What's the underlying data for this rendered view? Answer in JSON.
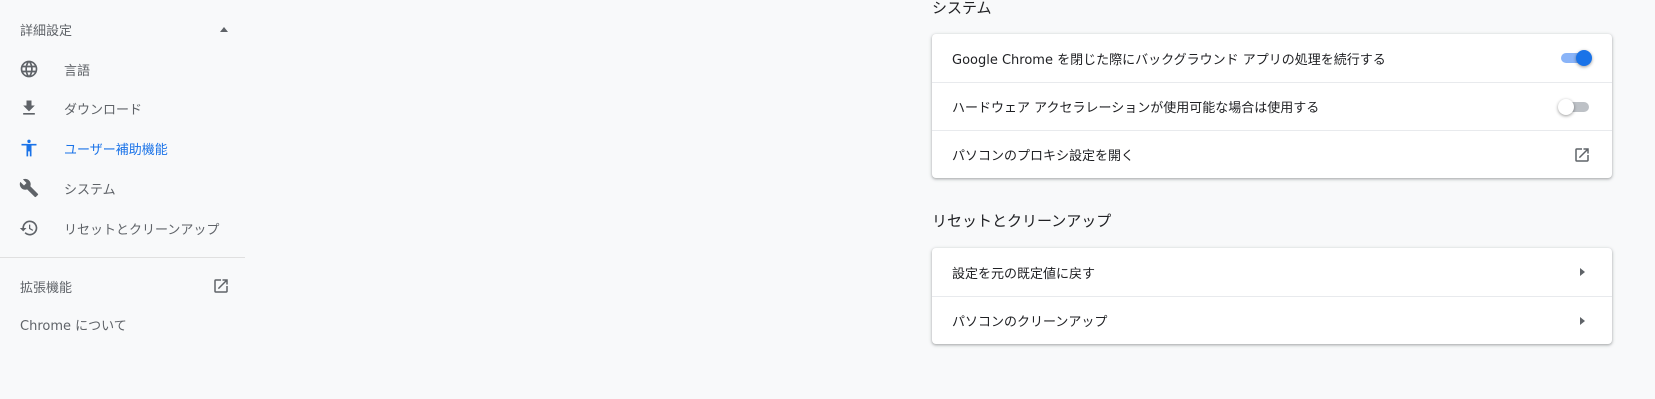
{
  "sidebar": {
    "advanced_label": "詳細設定",
    "items": [
      {
        "label": "言語",
        "icon": "globe-icon"
      },
      {
        "label": "ダウンロード",
        "icon": "download-icon"
      },
      {
        "label": "ユーザー補助機能",
        "icon": "accessibility-icon",
        "active": true
      },
      {
        "label": "システム",
        "icon": "wrench-icon"
      },
      {
        "label": "リセットとクリーンアップ",
        "icon": "restore-icon"
      }
    ],
    "extensions_label": "拡張機能",
    "about_label": "Chrome について"
  },
  "system": {
    "title": "システム",
    "rows": [
      {
        "label": "Google Chrome を閉じた際にバックグラウンド アプリの処理を続行する",
        "control": "toggle",
        "enabled": true
      },
      {
        "label": "ハードウェア アクセラレーションが使用可能な場合は使用する",
        "control": "toggle",
        "enabled": false
      },
      {
        "label": "パソコンのプロキシ設定を開く",
        "control": "external-link"
      }
    ]
  },
  "reset": {
    "title": "リセットとクリーンアップ",
    "rows": [
      {
        "label": "設定を元の既定値に戻す",
        "control": "arrow"
      },
      {
        "label": "パソコンのクリーンアップ",
        "control": "arrow"
      }
    ]
  },
  "colors": {
    "accent": "#1a73e8",
    "background": "#f8f9fa",
    "text_secondary": "#5f6368"
  }
}
